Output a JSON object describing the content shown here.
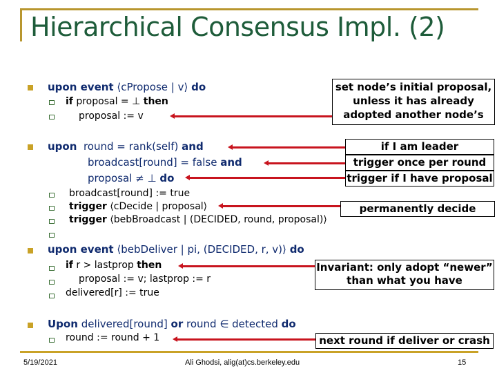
{
  "title": "Hierarchical Consensus Impl. (2)",
  "blocks": [
    {
      "head": [
        {
          "t": "upon event ",
          "bold": true
        },
        {
          "t": "⟨c",
          "bold": false
        },
        {
          "t": "Propose | v⟩ ",
          "bold": false
        },
        {
          "t": "do",
          "bold": true
        }
      ],
      "head_text": "upon event ⟨cPropose | v⟩ do",
      "subs": [
        "if proposal = ⊥ then",
        "proposal := v"
      ]
    },
    {
      "head_lines": [
        "upon  round = rank(self) and",
        "broadcast[round] = false and",
        "proposal ≠ ⊥ do"
      ],
      "subs": [
        "broadcast[round] := true",
        "trigger ⟨cDecide | proposal⟩",
        "trigger ⟨bebBroadcast | (DECIDED, round, proposal)⟩",
        ""
      ]
    },
    {
      "head_text": "upon event ⟨bebDeliver | pi, (DECIDED, r, v)⟩ do",
      "subs": [
        "if r > lastprop then",
        "proposal := v; lastprop := r",
        "delivered[r] := true"
      ]
    },
    {
      "head_text": "Upon delivered[round] or round ∈ detected do",
      "subs": [
        "round := round + 1"
      ]
    }
  ],
  "parts": {
    "b1_kw1": "upon event",
    "b1_rest": "⟨cPropose | v⟩",
    "b1_kw2": "do",
    "b1_s1_kw1": "if",
    "b1_s1_mid": "proposal = ⊥",
    "b1_s1_kw2": "then",
    "b1_s2": "proposal := v",
    "b2_kw": "upon",
    "b2_l1": "round = rank(self)",
    "b2_and": "and",
    "b2_l2": "broadcast[round] = false",
    "b2_l3": "proposal ≠ ⊥",
    "b2_do": "do",
    "b2_s1": "broadcast[round] := true",
    "b2_trigger": "trigger",
    "b2_s2_rest": "⟨cDecide | proposal⟩",
    "b2_s3_rest": "⟨bebBroadcast | (DECIDED, round, proposal)⟩",
    "b3_kw1": "upon event",
    "b3_rest": "⟨bebDeliver | pi, (DECIDED, r, v)⟩",
    "b3_kw2": "do",
    "b3_s1_kw1": "if",
    "b3_s1_mid": "r > lastprop",
    "b3_s1_kw2": "then",
    "b3_s2": "proposal := v; lastprop := r",
    "b3_s3": "delivered[r] := true",
    "b4_kw1": "Upon",
    "b4_mid1": "delivered[round]",
    "b4_or": "or",
    "b4_mid2": "round ∈ detected",
    "b4_do": "do",
    "b4_s1": "round := round + 1"
  },
  "annotations": {
    "initial_proposal": [
      "set node’s initial proposal,",
      "unless it has already",
      "adopted another node’s"
    ],
    "leader": "if I am leader",
    "once": "trigger once per round",
    "have_proposal": "trigger if I have proposal",
    "decide": "permanently decide",
    "invariant": [
      "Invariant: only adopt “newer”",
      "than what you have"
    ],
    "next_round": "next round if deliver or crash"
  },
  "footer": {
    "date": "5/19/2021",
    "author": "Ali Ghodsi, alig(at)cs.berkeley.edu",
    "page": "15"
  },
  "colors": {
    "title": "#1e5c3a",
    "accent_gold": "#b8962e",
    "keyword_blue": "#0f2a6e",
    "arrow_red": "#c8141e"
  }
}
